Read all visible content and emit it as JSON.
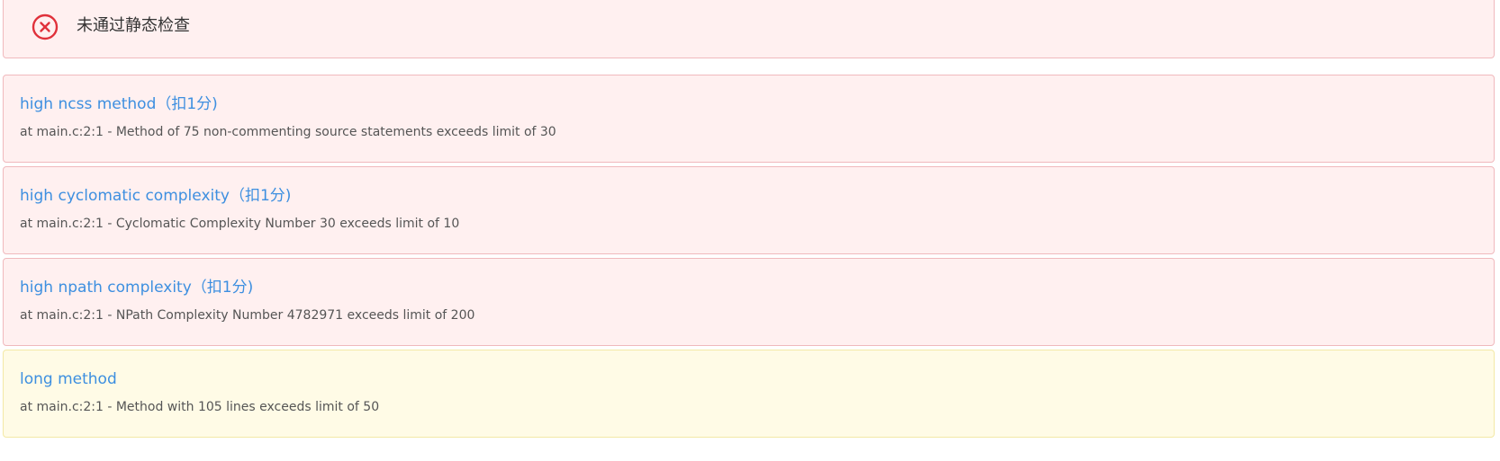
{
  "status": {
    "icon": "close-circle-icon",
    "text": "未通过静态检查",
    "color": "#e0313b"
  },
  "issues": [
    {
      "severity": "error",
      "title": "high ncss method（扣1分)",
      "description": "at main.c:2:1 - Method of 75 non-commenting source statements exceeds limit of 30"
    },
    {
      "severity": "error",
      "title": "high cyclomatic complexity（扣1分)",
      "description": "at main.c:2:1 - Cyclomatic Complexity Number 30 exceeds limit of 10"
    },
    {
      "severity": "error",
      "title": "high npath complexity（扣1分)",
      "description": "at main.c:2:1 - NPath Complexity Number 4782971 exceeds limit of 200"
    },
    {
      "severity": "warning",
      "title": "long method",
      "description": "at main.c:2:1 - Method with 105 lines exceeds limit of 50"
    }
  ]
}
